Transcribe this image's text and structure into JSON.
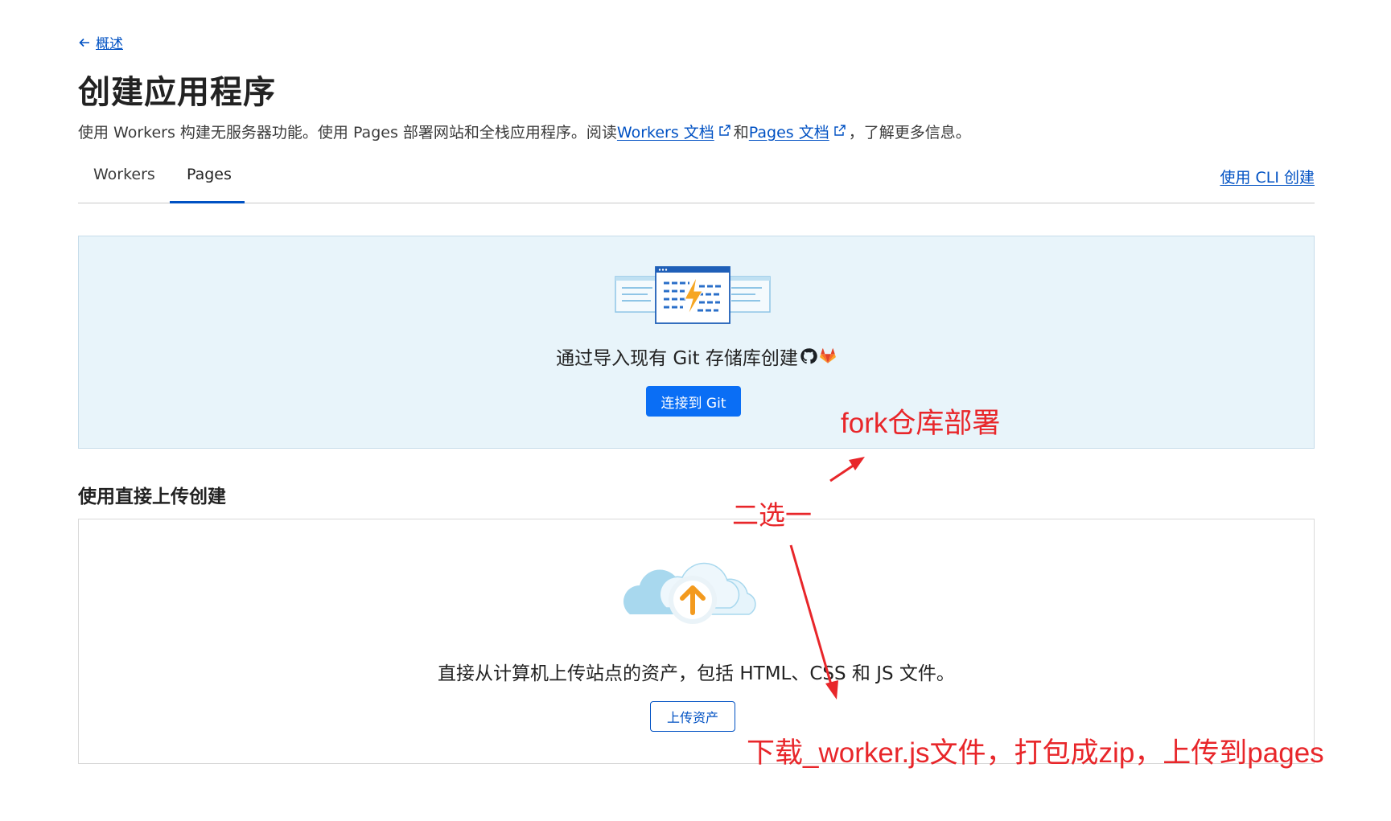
{
  "nav": {
    "back_label": "概述"
  },
  "page": {
    "title": "创建应用程序",
    "description": {
      "part1": "使用 Workers 构建无服务器功能。使用 Pages 部署网站和全栈应用程序。阅读",
      "link1": "Workers 文档",
      "part2": "和",
      "link2": "Pages 文档",
      "part3": "，了解更多信息。"
    }
  },
  "tabs": [
    {
      "label": "Workers",
      "active": false
    },
    {
      "label": "Pages",
      "active": true
    }
  ],
  "cli_link": "使用 CLI 创建",
  "git_section": {
    "text": "通过导入现有 Git 存储库创建",
    "icons": [
      "github-icon",
      "gitlab-icon"
    ],
    "button": "连接到 Git"
  },
  "upload_section": {
    "heading": "使用直接上传创建",
    "text": "直接从计算机上传站点的资产，包括 HTML、CSS 和 JS 文件。",
    "button": "上传资产"
  },
  "annotations": {
    "fork": "fork仓库部署",
    "choose": "二选一",
    "download": "下载_worker.js文件，打包成zip，上传到pages"
  },
  "colors": {
    "accent": "#0051c3",
    "primary_button": "#0a6ef5",
    "annotation": "#e8262a",
    "git_bg": "#e8f4fa"
  }
}
